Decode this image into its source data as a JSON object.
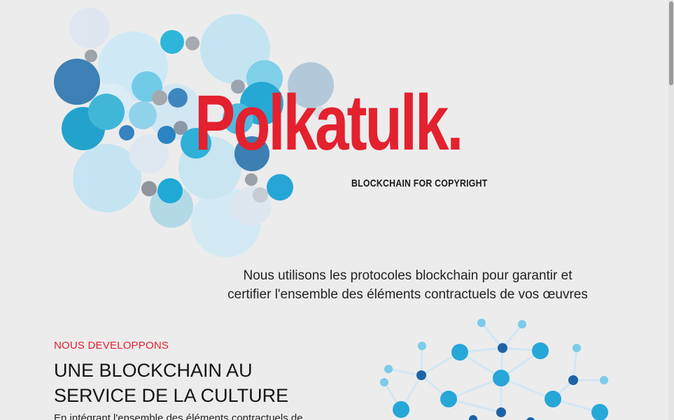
{
  "brand": {
    "name": "Polkatulk.",
    "tagline": "BLOCKCHAIN FOR COPYRIGHT",
    "colors": {
      "red": "#e3212f",
      "text": "#141414",
      "background": "#ececec"
    }
  },
  "hero": {
    "intro_line1": "Nous utilisons les protocoles blockchain pour garantir et",
    "intro_line2": "certifier l'ensemble des éléments contractuels de vos œuvres"
  },
  "section": {
    "kicker": "NOUS DEVELOPPONS",
    "heading_line1": "UNE BLOCKCHAIN AU",
    "heading_line2": "SERVICE DE LA CULTURE",
    "body": "En intégrant l'ensemble des éléments contractuels de"
  },
  "decorations": {
    "logo_graphic": "bubble-cluster-graphic",
    "section_graphic": "network-nodes-graphic"
  }
}
